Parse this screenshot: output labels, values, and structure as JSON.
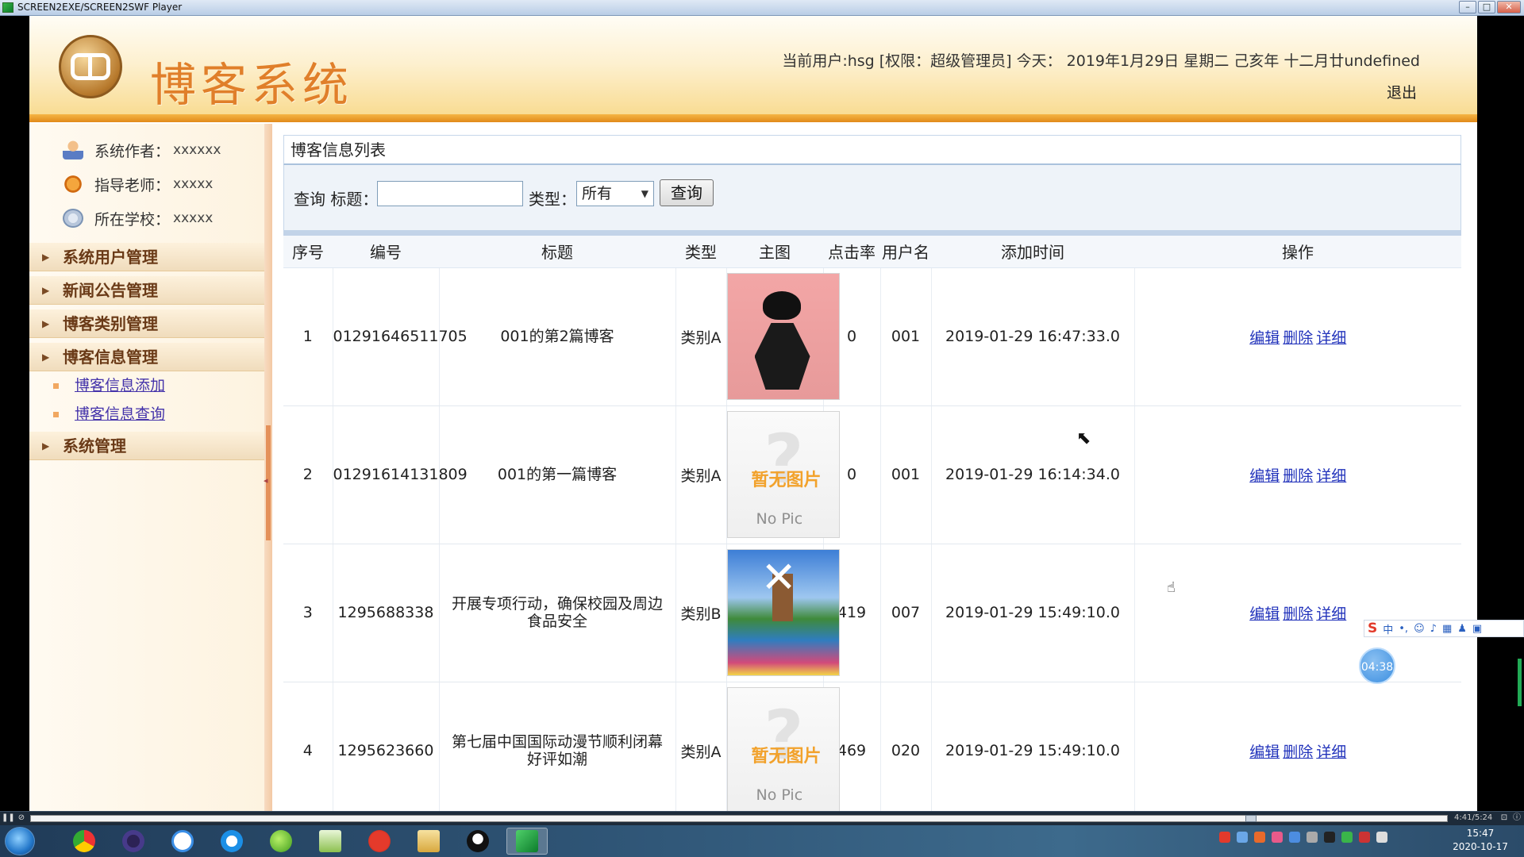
{
  "window": {
    "title": "SCREEN2EXE/SCREEN2SWF Player",
    "controls": [
      "–",
      "□",
      "✕"
    ]
  },
  "header": {
    "system_name": "博客系统",
    "user_info": "当前用户:hsg [权限：超级管理员] 今天： 2019年1月29日 星期二 己亥年 十二月廿undefined",
    "logout_label": "退出"
  },
  "sidebar": {
    "info": [
      {
        "label": "系统作者：",
        "value": "xxxxxx",
        "icon": "author-icon"
      },
      {
        "label": "指导老师：",
        "value": "xxxxx",
        "icon": "teacher-icon"
      },
      {
        "label": "所在学校：",
        "value": "xxxxx",
        "icon": "school-icon"
      }
    ],
    "menu": [
      {
        "label": "系统用户管理"
      },
      {
        "label": "新闻公告管理"
      },
      {
        "label": "博客类别管理"
      },
      {
        "label": "博客信息管理"
      },
      {
        "label": "系统管理"
      }
    ],
    "submenu": [
      {
        "label": "博客信息添加"
      },
      {
        "label": "博客信息查询"
      }
    ]
  },
  "main": {
    "panel_title": "博客信息列表",
    "search": {
      "title_label": "查询 标题：",
      "title_value": "",
      "type_label": "类型：",
      "type_selected": "所有",
      "button_label": "查询"
    },
    "columns": [
      "序号",
      "编号",
      "标题",
      "类型",
      "主图",
      "点击率",
      "用户名",
      "添加时间",
      "操作"
    ],
    "rows": [
      {
        "index": "1",
        "code": "01291646511705",
        "title": "001的第2篇博客",
        "type": "类别A",
        "image": "luffy-image",
        "clicks": "0",
        "user": "001",
        "time": "2019-01-29 16:47:33.0"
      },
      {
        "index": "2",
        "code": "01291614131809",
        "title": "001的第一篇博客",
        "type": "类别A",
        "image": "no-pic",
        "clicks": "0",
        "user": "001",
        "time": "2019-01-29 16:14:34.0"
      },
      {
        "index": "3",
        "code": "1295688338",
        "title": "开展专项行动，确保校园及周边食品安全",
        "type": "类别B",
        "image": "windmill-image",
        "clicks": "419",
        "user": "007",
        "time": "2019-01-29 15:49:10.0"
      },
      {
        "index": "4",
        "code": "1295623660",
        "title": "第七届中国国际动漫节顺利闭幕 好评如潮",
        "type": "类别A",
        "image": "no-pic",
        "clicks": "469",
        "user": "020",
        "time": "2019-01-29 15:49:10.0"
      }
    ],
    "ops": {
      "edit": "编辑",
      "delete": "删除",
      "detail": "详细"
    },
    "nopic": {
      "cn": "暂无图片",
      "en": "No Pic"
    }
  },
  "overlay": {
    "timer": "04:38",
    "ime": "中"
  },
  "player": {
    "time": "4:41/5:24"
  },
  "taskbar": {
    "time": "15:47",
    "date": "2020-10-17"
  },
  "colors": {
    "accent_orange": "#e18a19",
    "title_orange": "#e07f2a",
    "link_blue": "#2233bb",
    "menu_brown": "#6a3a17"
  }
}
